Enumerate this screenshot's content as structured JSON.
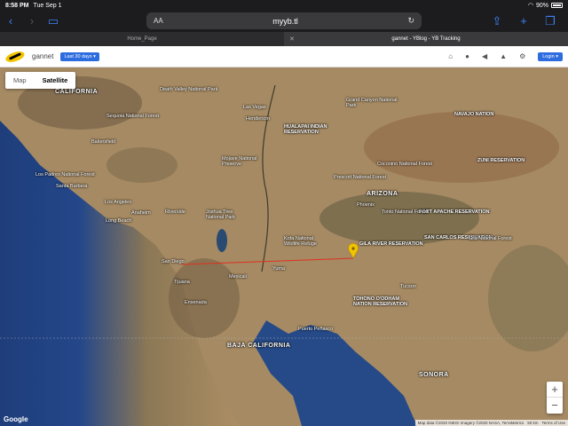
{
  "statusbar": {
    "time": "8:58 PM",
    "date": "Tue Sep 1",
    "battery": "90%"
  },
  "browser": {
    "aa": "AA",
    "url": "myyb.tl",
    "tabs": [
      {
        "label": "Home_Page",
        "active": false
      },
      {
        "label": "gannet - YBlog - YB Tracking",
        "active": true
      }
    ]
  },
  "app": {
    "title": "gannet",
    "period": "Last 30 days",
    "login": "Login"
  },
  "map": {
    "toggle": {
      "map": "Map",
      "satellite": "Satellite"
    },
    "zoom_in": "+",
    "zoom_out": "−",
    "google": "Google",
    "attribution": [
      "Map data ©2020 INEGI Imagery ©2020 NASA, TerraMetrics",
      "50 km",
      "Terms of Use"
    ],
    "labels": {
      "california": "CALIFORNIA",
      "arizona": "ARIZONA",
      "baja": "BAJA CALIFORNIA",
      "sonora": "SONORA",
      "las_vegas": "Las Vegas",
      "henderson": "Henderson",
      "los_angeles": "Los Angeles",
      "long_beach": "Long Beach",
      "anaheim": "Anaheim",
      "riverside": "Riverside",
      "san_diego": "San Diego",
      "tijuana": "Tijuana",
      "ensenada": "Ensenada",
      "mexicali": "Mexicali",
      "yuma": "Yuma",
      "phoenix": "Phoenix",
      "tucson": "Tucson",
      "bakersfield": "Bakersfield",
      "santa_barbara": "Santa Barbara",
      "navajo": "NAVAJO NATION",
      "hualapai": "HUALAPAI INDIAN RESERVATION",
      "fort_apache": "FORT APACHE RESERVATION",
      "san_carlos": "SAN CARLOS RESERVATION",
      "zuni": "ZUNI RESERVATION",
      "gila_river": "GILA RIVER RESERVATION",
      "tohono": "TOHONO O'ODHAM NATION RESERVATION",
      "sequoia": "Sequoia National Forest",
      "mojave": "Mojave National Preserve",
      "prescott": "Prescott National Forest",
      "coconino": "Coconino National Forest",
      "tonto": "Tonto National Forest",
      "joshua": "Joshua Tree National Park",
      "kofa": "Kofa National Wildlife Refuge",
      "puerto_penasco": "Puerto Peñasco",
      "grand_canyon": "Grand Canyon National Park",
      "los_padres": "Los Padres National Forest",
      "gila_forest": "Gila National Forest",
      "death_valley": "Death Valley National Park"
    }
  },
  "colors": {
    "track": "#e0301e",
    "marker": "#f2c300",
    "accent": "#2d6cdf"
  }
}
